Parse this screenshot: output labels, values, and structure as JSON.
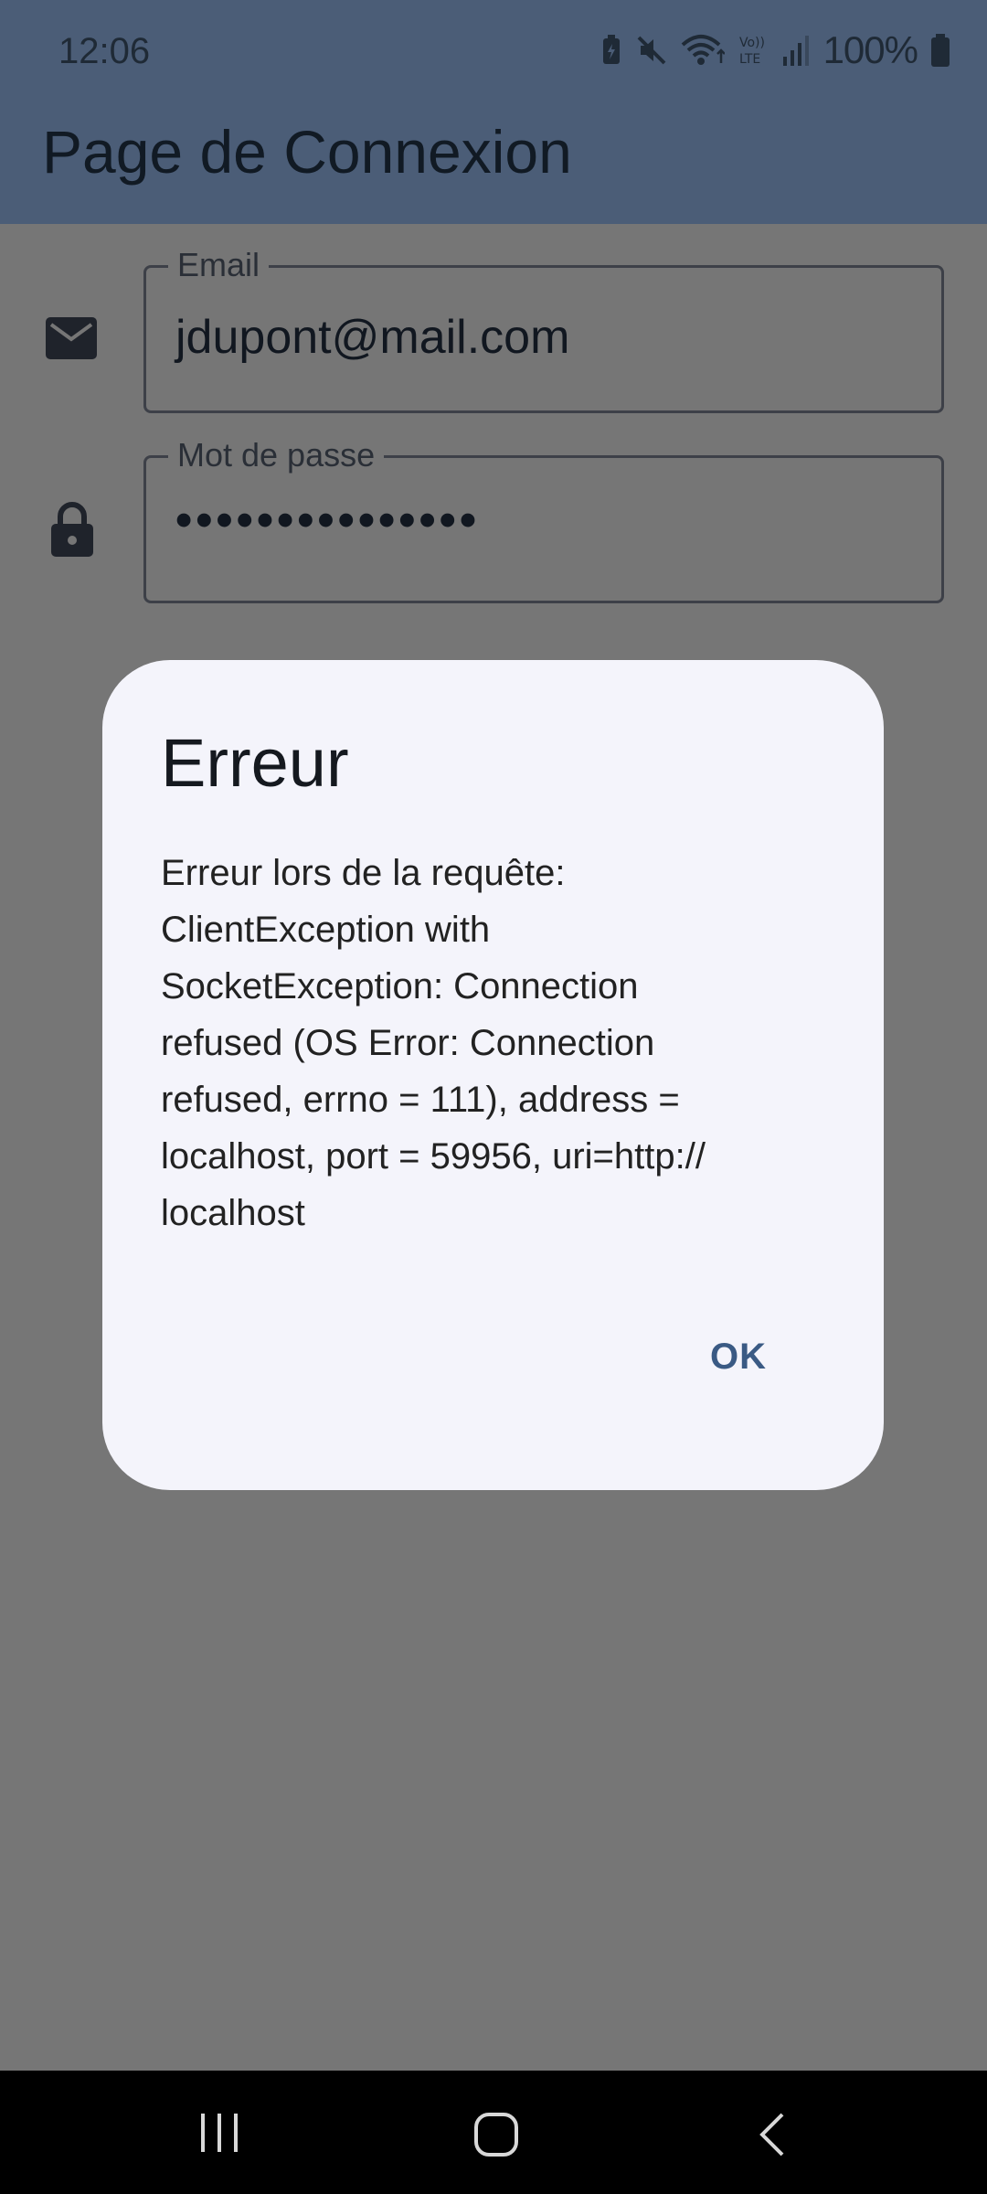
{
  "status_bar": {
    "time": "12:06",
    "battery": "100%",
    "icons": [
      "battery-saver-icon",
      "mute-icon",
      "wifi-icon",
      "volte-icon",
      "signal-icon",
      "battery-icon"
    ]
  },
  "app_bar": {
    "title": "Page de Connexion"
  },
  "form": {
    "email": {
      "label": "Email",
      "value": "jdupont@mail.com",
      "icon": "mail-icon"
    },
    "password": {
      "label": "Mot de passe",
      "value": "•••••••••••••••",
      "icon": "lock-icon"
    }
  },
  "dialog": {
    "title": "Erreur",
    "message_lines": [
      "Erreur lors de la requête:",
      "ClientException with",
      "SocketException: Connection",
      "refused (OS Error: Connection",
      "refused, errno = 111), address =",
      "localhost, port = 59956, uri=http://",
      "localhost"
    ],
    "ok_label": "OK"
  },
  "nav_bar": {
    "buttons": [
      "recents-icon",
      "home-icon",
      "back-icon"
    ]
  },
  "colors": {
    "app_bar": "#4b5d77",
    "scrim": "#767676",
    "dialog_bg": "#f4f4fb",
    "accent": "#3a5a84"
  }
}
